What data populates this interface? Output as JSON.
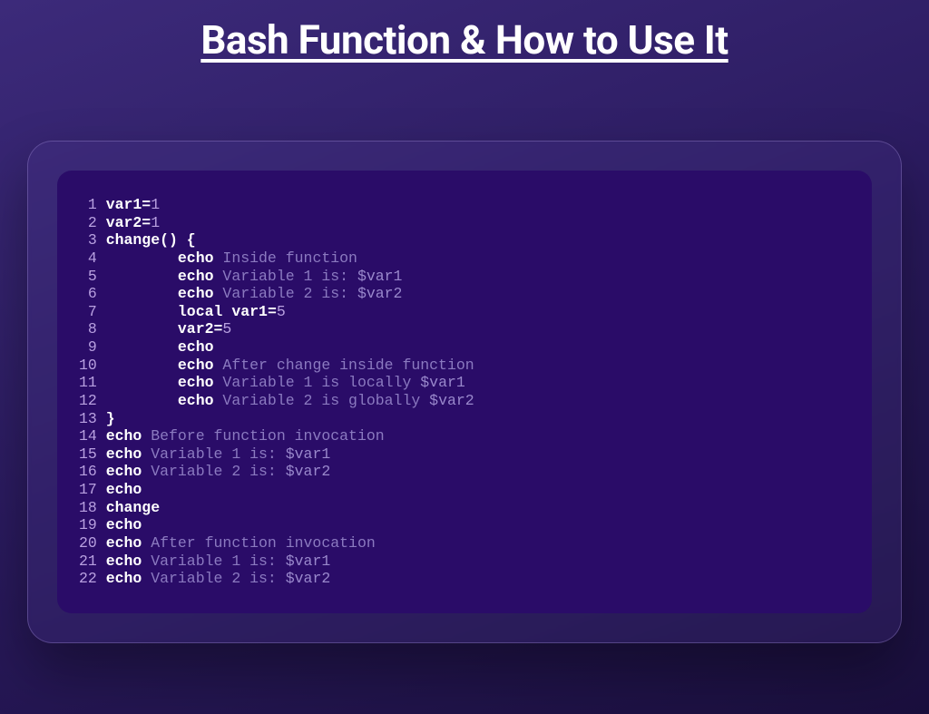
{
  "title": "Bash Function & How to Use It",
  "code": {
    "lines": [
      {
        "n": "1",
        "tokens": [
          [
            "kw",
            "var1"
          ],
          [
            "op",
            "="
          ],
          [
            "num",
            "1"
          ]
        ]
      },
      {
        "n": "2",
        "tokens": [
          [
            "kw",
            "var2"
          ],
          [
            "op",
            "="
          ],
          [
            "num",
            "1"
          ]
        ]
      },
      {
        "n": "3",
        "tokens": [
          [
            "kw",
            "change() {"
          ]
        ]
      },
      {
        "n": "4",
        "tokens": [
          [
            "",
            "        "
          ],
          [
            "cmd",
            "echo"
          ],
          [
            "",
            " "
          ],
          [
            "str",
            "Inside function"
          ]
        ]
      },
      {
        "n": "5",
        "tokens": [
          [
            "",
            "        "
          ],
          [
            "cmd",
            "echo"
          ],
          [
            "",
            " "
          ],
          [
            "str",
            "Variable 1 is: "
          ],
          [
            "var",
            "$var1"
          ]
        ]
      },
      {
        "n": "6",
        "tokens": [
          [
            "",
            "        "
          ],
          [
            "cmd",
            "echo"
          ],
          [
            "",
            " "
          ],
          [
            "str",
            "Variable 2 is: "
          ],
          [
            "var",
            "$var2"
          ]
        ]
      },
      {
        "n": "7",
        "tokens": [
          [
            "",
            "        "
          ],
          [
            "kw",
            "local var1"
          ],
          [
            "op",
            "="
          ],
          [
            "num",
            "5"
          ]
        ]
      },
      {
        "n": "8",
        "tokens": [
          [
            "",
            "        "
          ],
          [
            "kw",
            "var2"
          ],
          [
            "op",
            "="
          ],
          [
            "num",
            "5"
          ]
        ]
      },
      {
        "n": "9",
        "tokens": [
          [
            "",
            "        "
          ],
          [
            "cmd",
            "echo"
          ]
        ]
      },
      {
        "n": "10",
        "tokens": [
          [
            "",
            "        "
          ],
          [
            "cmd",
            "echo"
          ],
          [
            "",
            " "
          ],
          [
            "str",
            "After change inside function"
          ]
        ]
      },
      {
        "n": "11",
        "tokens": [
          [
            "",
            "        "
          ],
          [
            "cmd",
            "echo"
          ],
          [
            "",
            " "
          ],
          [
            "str",
            "Variable 1 is locally "
          ],
          [
            "var",
            "$var1"
          ]
        ]
      },
      {
        "n": "12",
        "tokens": [
          [
            "",
            "        "
          ],
          [
            "cmd",
            "echo"
          ],
          [
            "",
            " "
          ],
          [
            "str",
            "Variable 2 is globally "
          ],
          [
            "var",
            "$var2"
          ]
        ]
      },
      {
        "n": "13",
        "tokens": [
          [
            "kw",
            "}"
          ]
        ]
      },
      {
        "n": "14",
        "tokens": [
          [
            "cmd",
            "echo"
          ],
          [
            "",
            " "
          ],
          [
            "str",
            "Before function invocation"
          ]
        ]
      },
      {
        "n": "15",
        "tokens": [
          [
            "cmd",
            "echo"
          ],
          [
            "",
            " "
          ],
          [
            "str",
            "Variable 1 is: "
          ],
          [
            "var",
            "$var1"
          ]
        ]
      },
      {
        "n": "16",
        "tokens": [
          [
            "cmd",
            "echo"
          ],
          [
            "",
            " "
          ],
          [
            "str",
            "Variable 2 is: "
          ],
          [
            "var",
            "$var2"
          ]
        ]
      },
      {
        "n": "17",
        "tokens": [
          [
            "cmd",
            "echo"
          ]
        ]
      },
      {
        "n": "18",
        "tokens": [
          [
            "cmd",
            "change"
          ]
        ]
      },
      {
        "n": "19",
        "tokens": [
          [
            "cmd",
            "echo"
          ]
        ]
      },
      {
        "n": "20",
        "tokens": [
          [
            "cmd",
            "echo"
          ],
          [
            "",
            " "
          ],
          [
            "str",
            "After function invocation"
          ]
        ]
      },
      {
        "n": "21",
        "tokens": [
          [
            "cmd",
            "echo"
          ],
          [
            "",
            " "
          ],
          [
            "str",
            "Variable 1 is: "
          ],
          [
            "var",
            "$var1"
          ]
        ]
      },
      {
        "n": "22",
        "tokens": [
          [
            "cmd",
            "echo"
          ],
          [
            "",
            " "
          ],
          [
            "str",
            "Variable 2 is: "
          ],
          [
            "var",
            "$var2"
          ]
        ]
      }
    ]
  }
}
